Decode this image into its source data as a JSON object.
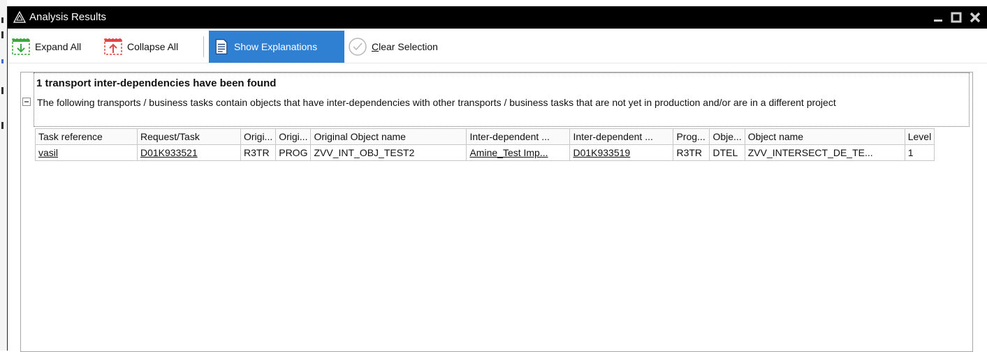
{
  "window": {
    "title": "Analysis Results",
    "icon": "triangle-logo-icon",
    "controls": {
      "minimize": "minimize-icon",
      "maximize": "maximize-icon",
      "close": "close-icon"
    }
  },
  "toolbar": {
    "expand_all": "Expand All",
    "collapse_all": "Collapse All",
    "show_explanations": "Show Explanations",
    "clear_selection": "Clear Selection",
    "accent": "#2f7fd3"
  },
  "section": {
    "heading": "1 transport inter-dependencies have been found",
    "description": "The following transports / business tasks contain objects that have inter-dependencies with other transports / business tasks that are not yet in production and/or are in a different project"
  },
  "table": {
    "headers": [
      "Task reference",
      "Request/Task",
      "Origi...",
      "Origi...",
      "Original Object name",
      "Inter-dependent ...",
      "Inter-dependent ...",
      "Prog...",
      "Obje...",
      "Object name",
      "Level"
    ],
    "rows": [
      [
        "vasil",
        "D01K933521",
        "R3TR",
        "PROG",
        "ZVV_INT_OBJ_TEST2",
        "Amine_Test Imp...",
        "D01K933519",
        "R3TR",
        "DTEL",
        "ZVV_INTERSECT_DE_TE...",
        "1"
      ]
    ]
  }
}
